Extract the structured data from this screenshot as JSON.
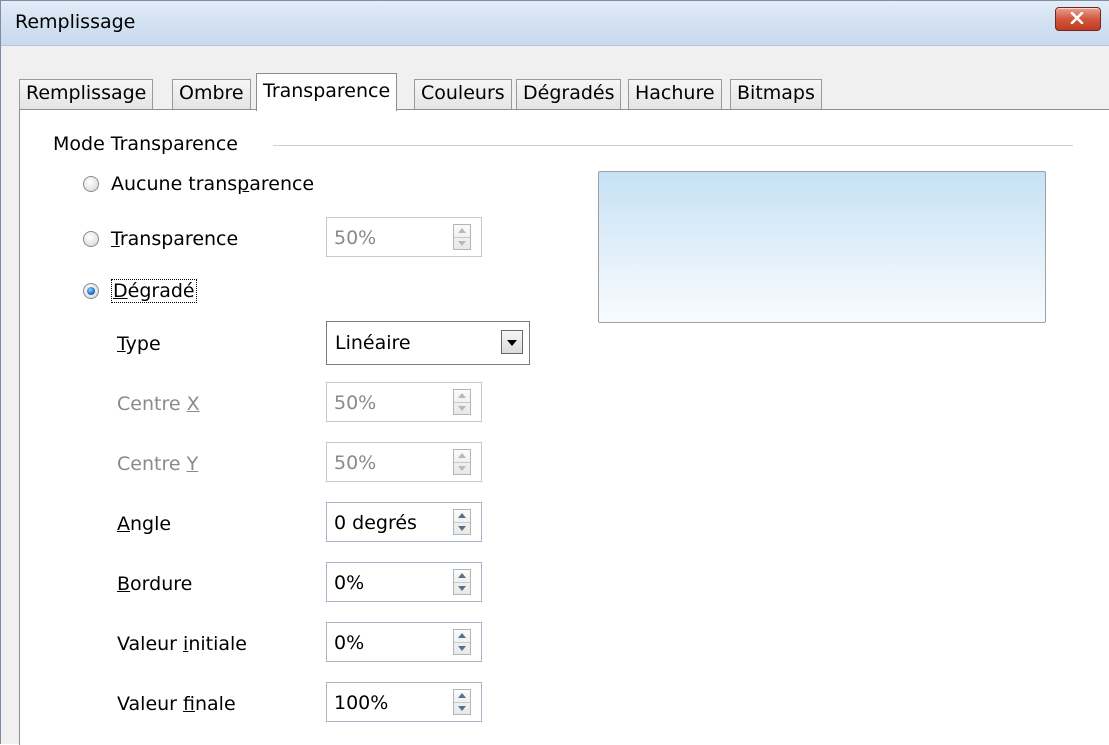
{
  "window": {
    "title": "Remplissage",
    "close_icon": "close-icon"
  },
  "tabs": [
    {
      "label": "Remplissage"
    },
    {
      "label": "Ombre"
    },
    {
      "label": "Transparence",
      "active": true
    },
    {
      "label": "Couleurs"
    },
    {
      "label": "Dégradés"
    },
    {
      "label": "Hachure"
    },
    {
      "label": "Bitmaps"
    }
  ],
  "group": {
    "title": "Mode Transparence"
  },
  "modes": {
    "none": {
      "pre": "Aucune trans",
      "key": "p",
      "post": "arence"
    },
    "transparency": {
      "pre": "",
      "key": "T",
      "post": "ransparence",
      "value": "50%"
    },
    "gradient": {
      "pre": "",
      "key": "D",
      "post": "égradé",
      "checked": true
    }
  },
  "fields": {
    "type": {
      "pre": "",
      "key": "T",
      "post": "ype",
      "value": "Linéaire"
    },
    "center_x": {
      "pre": "Centre ",
      "key": "X",
      "post": "",
      "value": "50%"
    },
    "center_y": {
      "pre": "Centre ",
      "key": "Y",
      "post": "",
      "value": "50%"
    },
    "angle": {
      "pre": "",
      "key": "A",
      "post": "ngle",
      "value": "0 degrés"
    },
    "border": {
      "pre": "",
      "key": "B",
      "post": "ordure",
      "value": "0%"
    },
    "start_value": {
      "pre": "Valeur ",
      "key": "i",
      "post": "nitiale",
      "value": "0%"
    },
    "end_value": {
      "pre": "Valeur ",
      "key": "f",
      "post": "inale",
      "value": "100%"
    }
  },
  "colors": {
    "preview_top": "#c6e1f5",
    "preview_bottom": "#f8fbfe",
    "close_button": "#c13a21"
  }
}
